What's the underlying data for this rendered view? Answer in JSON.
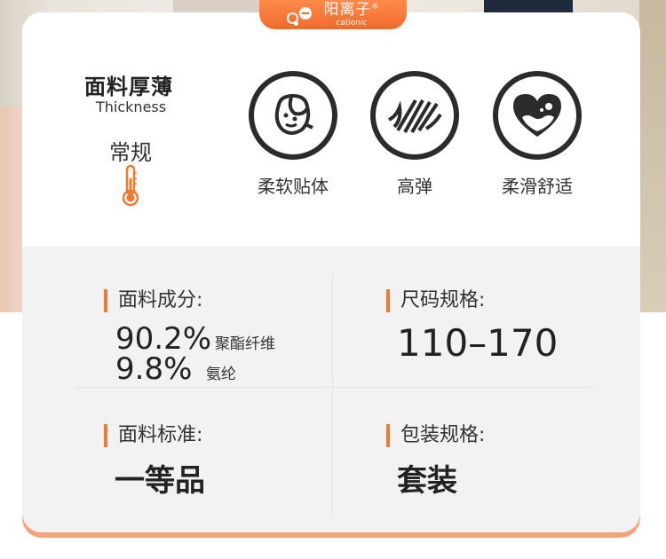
{
  "brand_badge": {
    "name": "阳离子",
    "reg": "®",
    "sub": "cationic"
  },
  "thickness": {
    "title": "面料厚薄",
    "subtitle": "Thickness",
    "value": "常规"
  },
  "features": [
    {
      "label": "柔软贴体",
      "icon": "face-soft-icon"
    },
    {
      "label": "高弹",
      "icon": "stretch-lines-icon"
    },
    {
      "label": "柔滑舒适",
      "icon": "heart-comfort-icon"
    }
  ],
  "composition": {
    "label": "面料成分:",
    "items": [
      {
        "percent": "90.2%",
        "material": "聚酯纤维"
      },
      {
        "percent": "9.8%",
        "material": "氨纶"
      }
    ]
  },
  "size": {
    "label": "尺码规格:",
    "value": "110–170"
  },
  "standard": {
    "label": "面料标准:",
    "value": "一等品"
  },
  "packaging": {
    "label": "包装规格:",
    "value": "套装"
  },
  "colors": {
    "accent": "#f07a2f",
    "icon": "#2b2b2b"
  }
}
